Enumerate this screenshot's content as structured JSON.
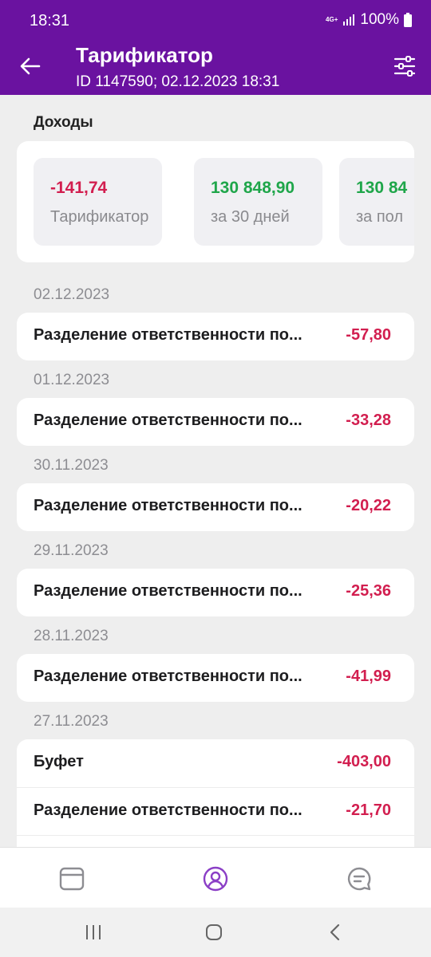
{
  "status_bar": {
    "time": "18:31",
    "network": "4G+",
    "battery": "100%"
  },
  "header": {
    "title": "Тарификатор",
    "subtitle": "ID 1147590; 02.12.2023 18:31",
    "back_icon": "arrow-left-icon",
    "filter_icon": "sliders-icon"
  },
  "income": {
    "title": "Доходы",
    "tiles": [
      {
        "value": "-141,74",
        "label": "Тарификатор",
        "tone": "negative"
      },
      {
        "value": "130 848,90",
        "label": "за 30 дней",
        "tone": "positive"
      },
      {
        "value": "130 84",
        "label": "за пол",
        "tone": "positive"
      }
    ]
  },
  "days": [
    {
      "date": "02.12.2023",
      "items": [
        {
          "name": "Разделение ответственности по...",
          "amount": "-57,80"
        }
      ]
    },
    {
      "date": "01.12.2023",
      "items": [
        {
          "name": "Разделение ответственности по...",
          "amount": "-33,28"
        }
      ]
    },
    {
      "date": "30.11.2023",
      "items": [
        {
          "name": "Разделение ответственности по...",
          "amount": "-20,22"
        }
      ]
    },
    {
      "date": "29.11.2023",
      "items": [
        {
          "name": "Разделение ответственности по...",
          "amount": "-25,36"
        }
      ]
    },
    {
      "date": "28.11.2023",
      "items": [
        {
          "name": "Разделение ответственности по...",
          "amount": "-41,99"
        }
      ]
    },
    {
      "date": "27.11.2023",
      "items": [
        {
          "name": "Буфет",
          "amount": "-403,00"
        },
        {
          "name": "Разделение ответственности по...",
          "amount": "-21,70"
        }
      ]
    }
  ],
  "colors": {
    "brand": "#6a12a0",
    "negative": "#d21e4f",
    "positive": "#1fa64a",
    "accent_nav": "#8b3fc6"
  },
  "bottom_nav": [
    {
      "icon": "card-icon",
      "active": false
    },
    {
      "icon": "profile-icon",
      "active": true
    },
    {
      "icon": "chat-icon",
      "active": false
    }
  ],
  "system_nav": {
    "recent_icon": "recents-icon",
    "home_icon": "home-icon",
    "back_icon": "back-icon"
  }
}
